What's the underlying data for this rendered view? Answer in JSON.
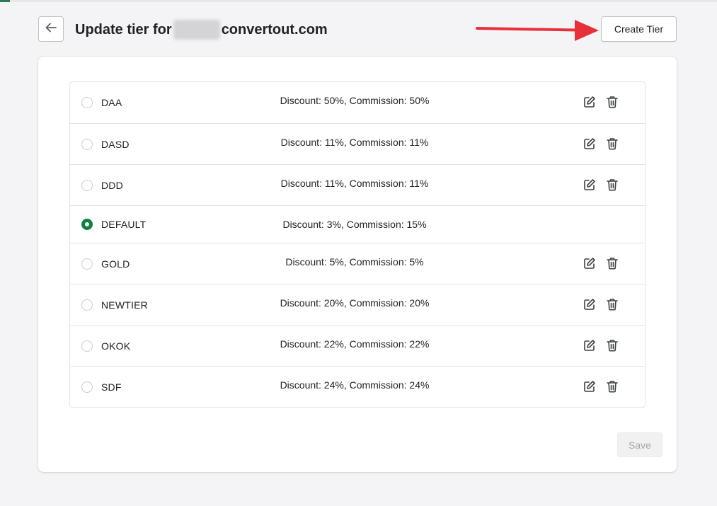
{
  "header": {
    "title_prefix": "Update tier for",
    "title_domain": "convertout.com",
    "create_button_label": "Create Tier"
  },
  "tiers": [
    {
      "name": "DAA",
      "info": "Discount: 50%, Commission: 50%",
      "selected": false,
      "editable": true
    },
    {
      "name": "DASD",
      "info": "Discount: 11%, Commission: 11%",
      "selected": false,
      "editable": true
    },
    {
      "name": "DDD",
      "info": "Discount: 11%, Commission: 11%",
      "selected": false,
      "editable": true
    },
    {
      "name": "DEFAULT",
      "info": "Discount: 3%, Commission: 15%",
      "selected": true,
      "editable": false
    },
    {
      "name": "GOLD",
      "info": "Discount: 5%, Commission: 5%",
      "selected": false,
      "editable": true
    },
    {
      "name": "NEWTIER",
      "info": "Discount: 20%, Commission: 20%",
      "selected": false,
      "editable": true
    },
    {
      "name": "OKOK",
      "info": "Discount: 22%, Commission: 22%",
      "selected": false,
      "editable": true
    },
    {
      "name": "SDF",
      "info": "Discount: 24%, Commission: 24%",
      "selected": false,
      "editable": true
    }
  ],
  "footer": {
    "save_label": "Save"
  },
  "icons": {
    "back": "arrow-left-icon",
    "edit": "edit-icon",
    "delete": "trash-icon",
    "annotation": "red-arrow"
  },
  "colors": {
    "selected_radio": "#108043",
    "annotation_arrow": "#e8303a"
  }
}
